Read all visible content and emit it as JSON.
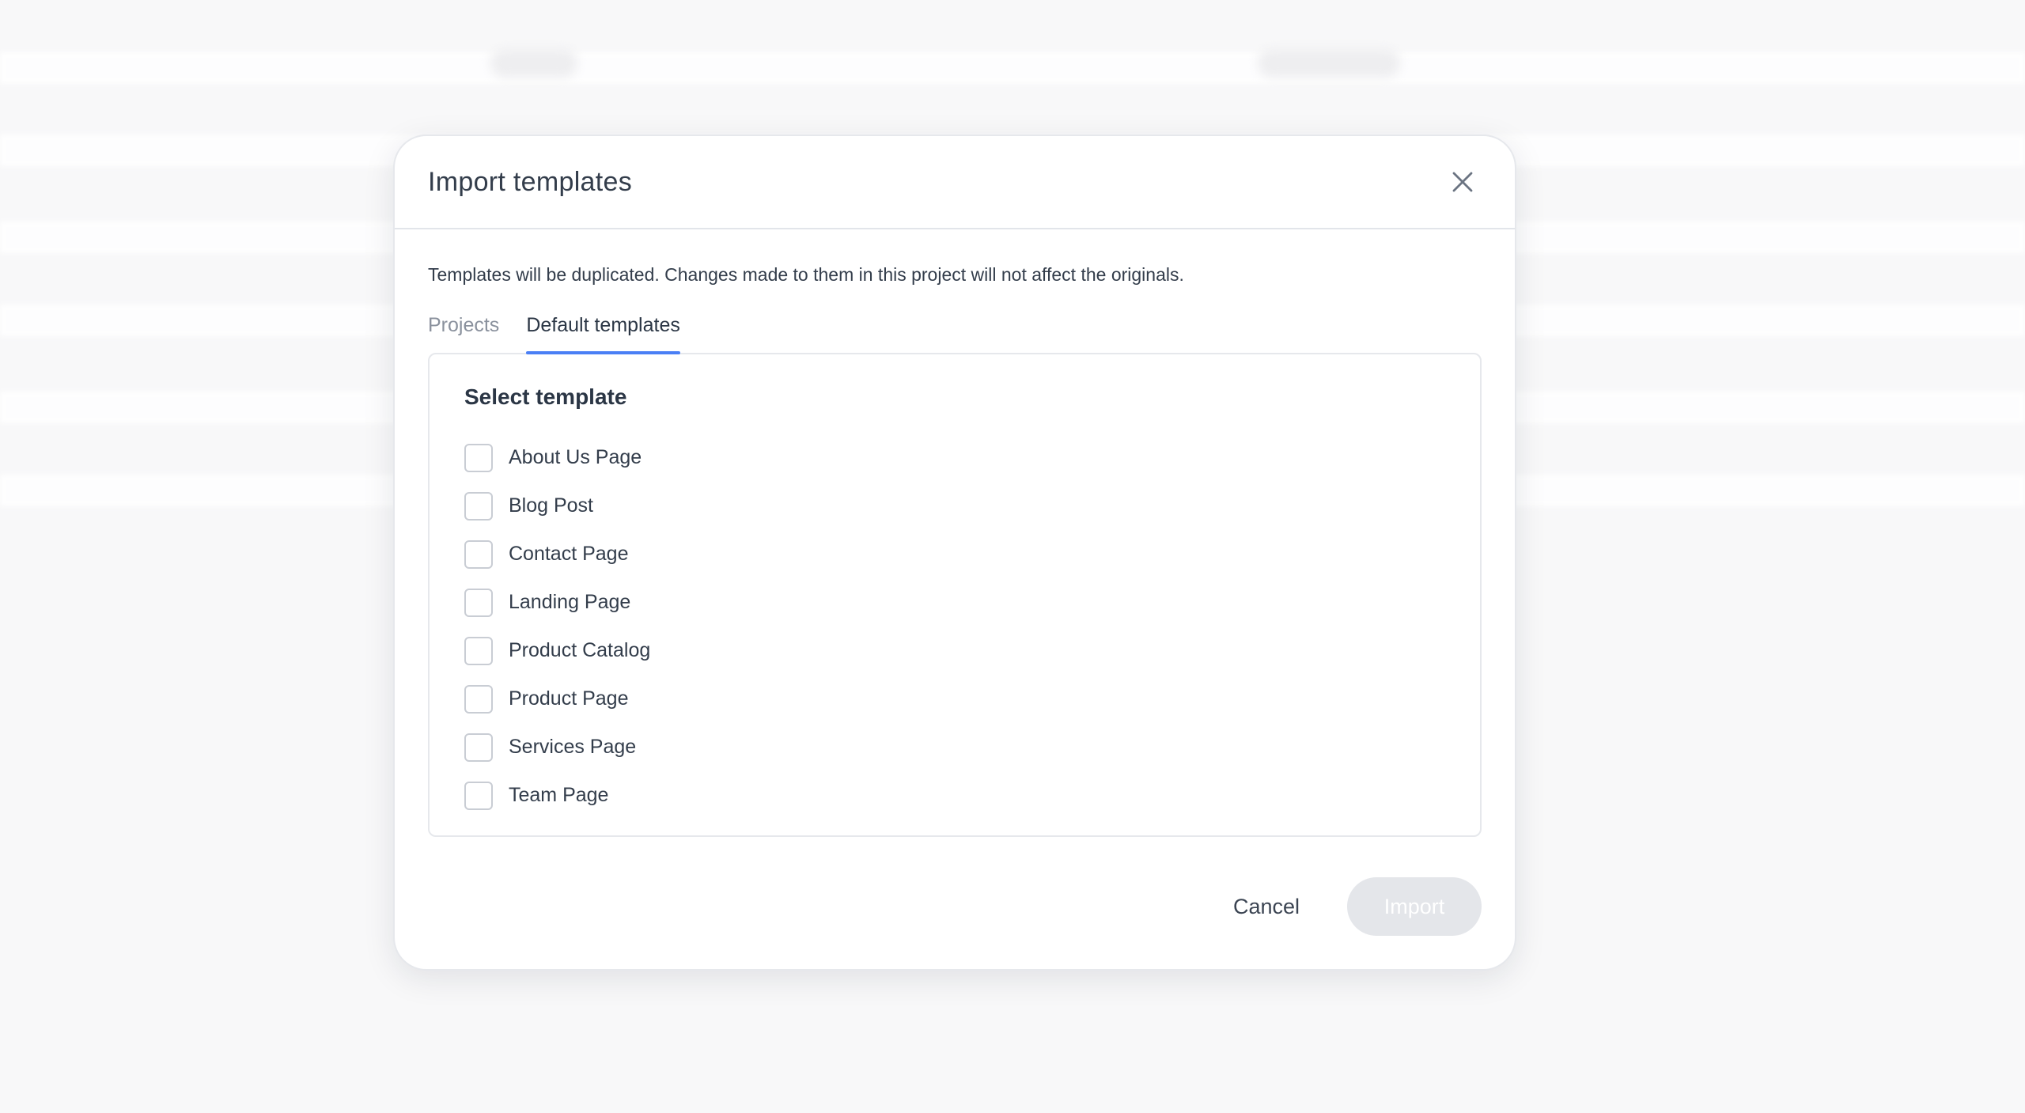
{
  "modal": {
    "title": "Import templates",
    "close_icon": "close-icon",
    "description": "Templates will be duplicated. Changes made to them in this project will not affect the originals.",
    "tabs": [
      {
        "label": "Projects",
        "active": false
      },
      {
        "label": "Default templates",
        "active": true
      }
    ],
    "panel": {
      "title": "Select template",
      "options": [
        {
          "label": "About Us Page",
          "checked": false
        },
        {
          "label": "Blog Post",
          "checked": false
        },
        {
          "label": "Contact Page",
          "checked": false
        },
        {
          "label": "Landing Page",
          "checked": false
        },
        {
          "label": "Product Catalog",
          "checked": false
        },
        {
          "label": "Product Page",
          "checked": false
        },
        {
          "label": "Services Page",
          "checked": false
        },
        {
          "label": "Team Page",
          "checked": false
        }
      ]
    },
    "footer": {
      "cancel_label": "Cancel",
      "import_label": "Import",
      "import_disabled": true
    }
  },
  "colors": {
    "accent": "#4a7ff5",
    "text": "#333d4b",
    "muted": "#8a919d",
    "disabled_button": "#e4e6ea"
  }
}
